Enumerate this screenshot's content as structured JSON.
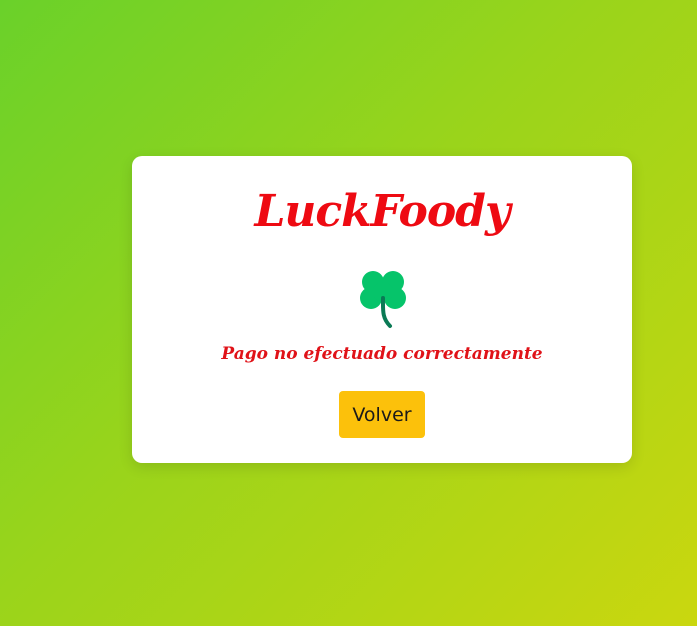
{
  "app": {
    "brand": "LuckFoody",
    "icon": "four-leaf-clover-icon",
    "message": "Pago no efectuado correctamente",
    "back_button_label": "Volver"
  },
  "colors": {
    "brand_red": "#ee0a12",
    "button_yellow": "#fcc10b",
    "clover_green": "#06c46a",
    "background_start": "#6ad12a",
    "background_end": "#cad70f"
  }
}
